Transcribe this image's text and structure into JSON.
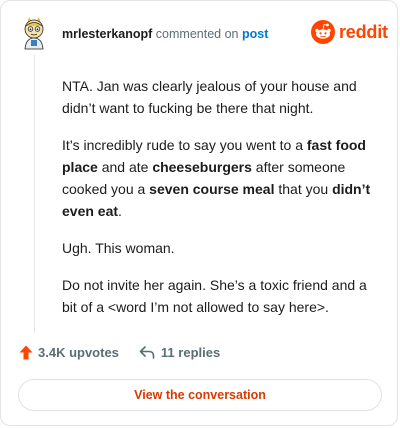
{
  "header": {
    "username": "mrlesterkanopf",
    "action_text": "commented on",
    "post_link": "post"
  },
  "brand": {
    "wordmark": "reddit",
    "icon": "reddit-snoo-icon",
    "color": "#ff4500"
  },
  "comment": {
    "paragraphs": [
      [
        {
          "text": "NTA. Jan was clearly jealous of your house and didn’t want to fucking be there that night.",
          "bold": false
        }
      ],
      [
        {
          "text": "It’s incredibly rude to say you went to a ",
          "bold": false
        },
        {
          "text": "fast food place",
          "bold": true
        },
        {
          "text": " and ate ",
          "bold": false
        },
        {
          "text": "cheeseburgers",
          "bold": true
        },
        {
          "text": " after someone cooked you a ",
          "bold": false
        },
        {
          "text": "seven course meal",
          "bold": true
        },
        {
          "text": " that you ",
          "bold": false
        },
        {
          "text": "didn’t even eat",
          "bold": true
        },
        {
          "text": ".",
          "bold": false
        }
      ],
      [
        {
          "text": "Ugh. This woman.",
          "bold": false
        }
      ],
      [
        {
          "text": "Do not invite her again. She’s a toxic friend and a bit of a <word I’m not allowed to say here>.",
          "bold": false
        }
      ]
    ]
  },
  "stats": {
    "upvotes": "3.4K upvotes",
    "replies": "11 replies",
    "upvote_color": "#ff4500"
  },
  "cta": {
    "label": "View the conversation",
    "color": "#d93a00"
  }
}
